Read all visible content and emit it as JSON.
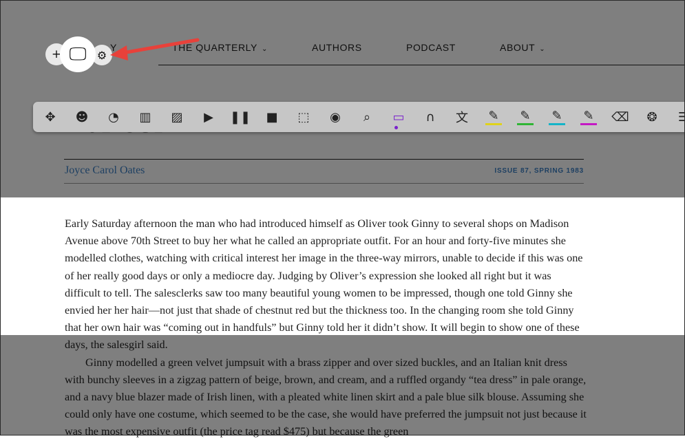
{
  "nav": {
    "partial_label": "Y",
    "items": [
      {
        "label": "THE QUARTERLY",
        "dropdown": true
      },
      {
        "label": "AUTHORS",
        "dropdown": false
      },
      {
        "label": "PODCAST",
        "dropdown": false
      },
      {
        "label": "ABOUT",
        "dropdown": true
      }
    ]
  },
  "article": {
    "title": "Nairobi",
    "author": "Joyce Carol Oates",
    "issue": "ISSUE 87, SPRING 1983",
    "paragraphs": [
      "Early Saturday afternoon the man who had introduced himself as Oliver took Ginny to several shops on Madison Avenue above 70th Street to buy her what he called an appropriate outfit. For an hour and forty-five minutes she modelled clothes, watching with critical interest her image in the three-way mirrors, unable to decide if this was one of her really good days or only a mediocre day. Judging by Oliver’s expression she looked all right but it was difficult to tell. The salesclerks saw too many beautiful young women to be impressed, though one told Ginny she envied her her hair—not just that shade of chestnut red but the thickness too. In the changing room she told Ginny that her own hair was “coming out in handfuls” but Ginny told her it didn’t show. It will begin to show one of these days, the salesgirl said.",
      "Ginny modelled a green velvet jumpsuit with a brass zipper and over sized buckles, and an Italian knit dress with bunchy sleeves in a zigzag pattern of beige, brown, and cream, and a ruffled organdy “tea dress” in pale orange, and a navy blue blazer made of Irish linen, with a pleated white linen skirt and a pale blue silk blouse. Assuming she could only have one costume, which seemed to be the case, she would have preferred the jumpsuit not just because it was the most expensive outfit (the price tag read $475) but because the green"
    ]
  },
  "mini_controls": {
    "icons": [
      "move-plus-icon",
      "screen-mask-icon",
      "settings-gear-icon"
    ],
    "glyphs": {
      "plus": "+",
      "screen": "🖵",
      "gear": "⚙"
    }
  },
  "toolbar": {
    "selected": "screen-mask-icon",
    "accent_color": "#7a22cc",
    "icons": [
      {
        "name": "drag-handle-icon",
        "glyph": "✥"
      },
      {
        "name": "talk-and-type-icon",
        "glyph": "☻"
      },
      {
        "name": "predict-icon",
        "glyph": "◔"
      },
      {
        "name": "dictionary-icon",
        "glyph": "▥"
      },
      {
        "name": "picture-dictionary-icon",
        "glyph": "▨"
      },
      {
        "name": "play-icon",
        "glyph": "▶"
      },
      {
        "name": "pause-icon",
        "glyph": "❚❚"
      },
      {
        "name": "stop-icon",
        "glyph": "■"
      },
      {
        "name": "screenshot-reader-icon",
        "glyph": "⬚"
      },
      {
        "name": "audio-maker-icon",
        "glyph": "◉"
      },
      {
        "name": "web-search-icon",
        "glyph": "⌕"
      },
      {
        "name": "screen-mask-icon",
        "glyph": "▭"
      },
      {
        "name": "voice-note-icon",
        "glyph": "∩"
      },
      {
        "name": "translator-icon",
        "glyph": "文"
      },
      {
        "name": "highlight-yellow-icon",
        "glyph": "✎",
        "color": "#e0d21a"
      },
      {
        "name": "highlight-green-icon",
        "glyph": "✎",
        "color": "#2fb534"
      },
      {
        "name": "highlight-blue-icon",
        "glyph": "✎",
        "color": "#14b4c8"
      },
      {
        "name": "highlight-pink-icon",
        "glyph": "✎",
        "color": "#c419c4"
      },
      {
        "name": "clear-highlights-icon",
        "glyph": "⌫"
      },
      {
        "name": "collect-highlights-icon",
        "glyph": "❂"
      },
      {
        "name": "menu-icon",
        "glyph": "☰"
      }
    ]
  }
}
